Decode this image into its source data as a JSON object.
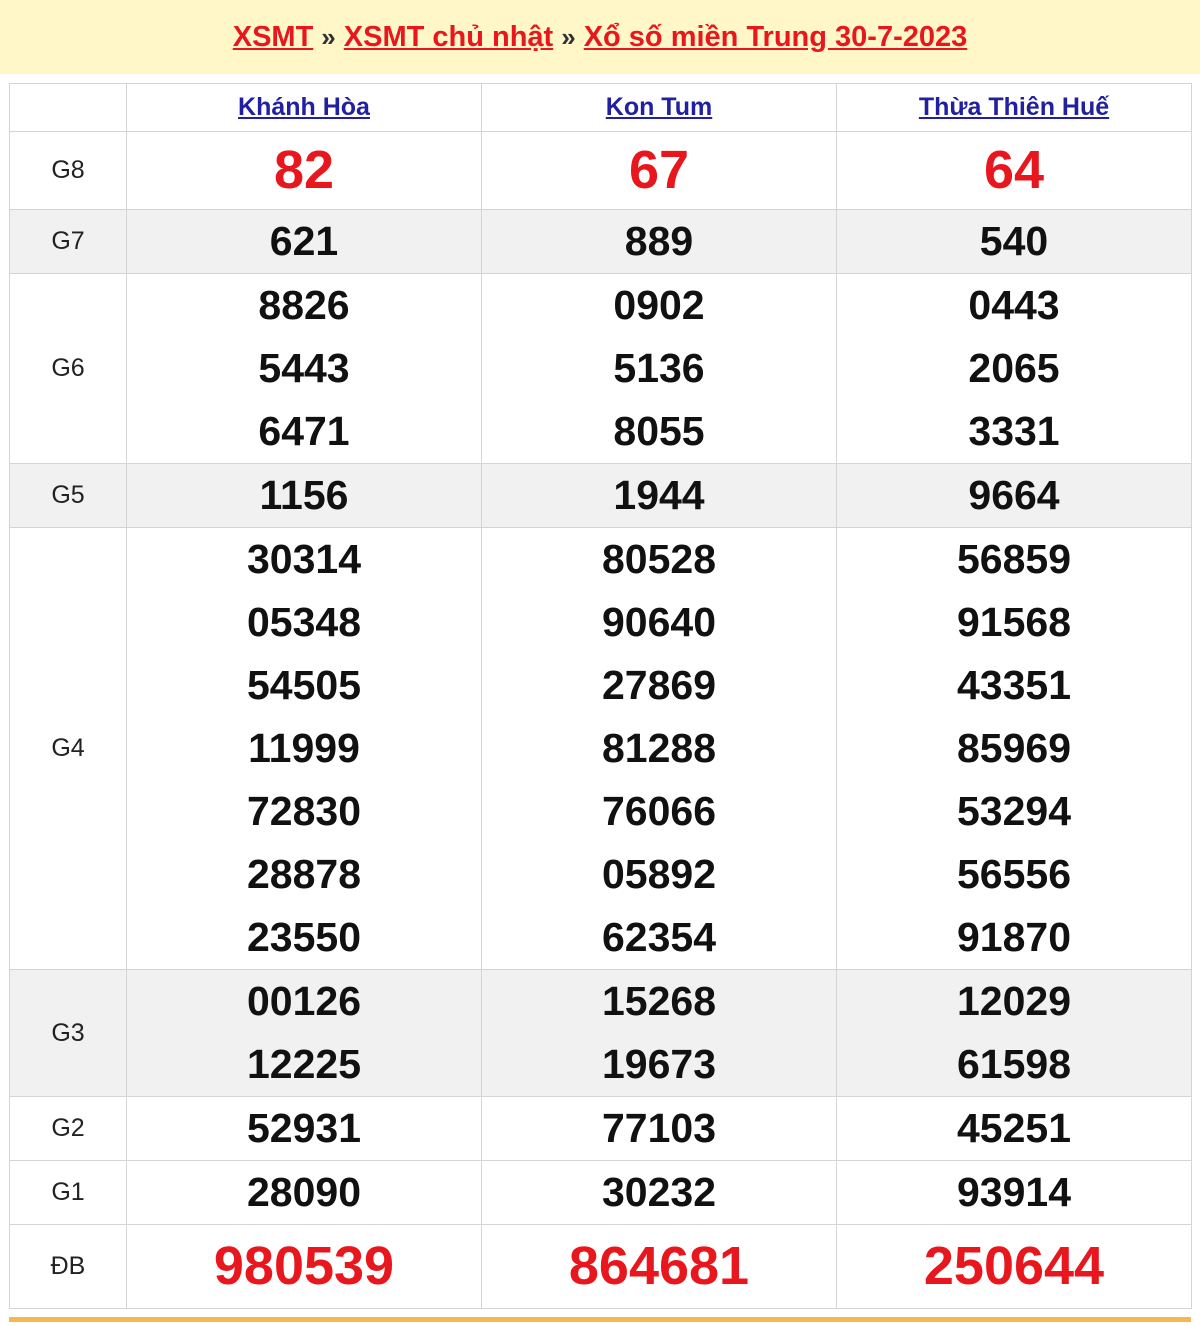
{
  "breadcrumb": {
    "link1": "XSMT",
    "sep1": "»",
    "link2": "XSMT chủ nhật",
    "sep2": "»",
    "link3": "Xổ số miền Trung 30-7-2023"
  },
  "provinces": [
    "Khánh Hòa",
    "Kon Tum",
    "Thừa Thiên Huế"
  ],
  "prizes": [
    {
      "label": "G8",
      "values": [
        [
          "82"
        ],
        [
          "67"
        ],
        [
          "64"
        ]
      ]
    },
    {
      "label": "G7",
      "values": [
        [
          "621"
        ],
        [
          "889"
        ],
        [
          "540"
        ]
      ]
    },
    {
      "label": "G6",
      "values": [
        [
          "8826",
          "5443",
          "6471"
        ],
        [
          "0902",
          "5136",
          "8055"
        ],
        [
          "0443",
          "2065",
          "3331"
        ]
      ]
    },
    {
      "label": "G5",
      "values": [
        [
          "1156"
        ],
        [
          "1944"
        ],
        [
          "9664"
        ]
      ]
    },
    {
      "label": "G4",
      "values": [
        [
          "30314",
          "05348",
          "54505",
          "11999",
          "72830",
          "28878",
          "23550"
        ],
        [
          "80528",
          "90640",
          "27869",
          "81288",
          "76066",
          "05892",
          "62354"
        ],
        [
          "56859",
          "91568",
          "43351",
          "85969",
          "53294",
          "56556",
          "91870"
        ]
      ]
    },
    {
      "label": "G3",
      "values": [
        [
          "00126",
          "12225"
        ],
        [
          "15268",
          "19673"
        ],
        [
          "12029",
          "61598"
        ]
      ]
    },
    {
      "label": "G2",
      "values": [
        [
          "52931"
        ],
        [
          "77103"
        ],
        [
          "45251"
        ]
      ]
    },
    {
      "label": "G1",
      "values": [
        [
          "28090"
        ],
        [
          "30232"
        ],
        [
          "93914"
        ]
      ]
    },
    {
      "label": "ĐB",
      "values": [
        [
          "980539"
        ],
        [
          "864681"
        ],
        [
          "250644"
        ]
      ]
    }
  ],
  "colors": {
    "accent_red": "#e8161d",
    "link_blue": "#2020a0",
    "header_bg": "#fff7c8",
    "row_alt": "#f1f1f1"
  }
}
